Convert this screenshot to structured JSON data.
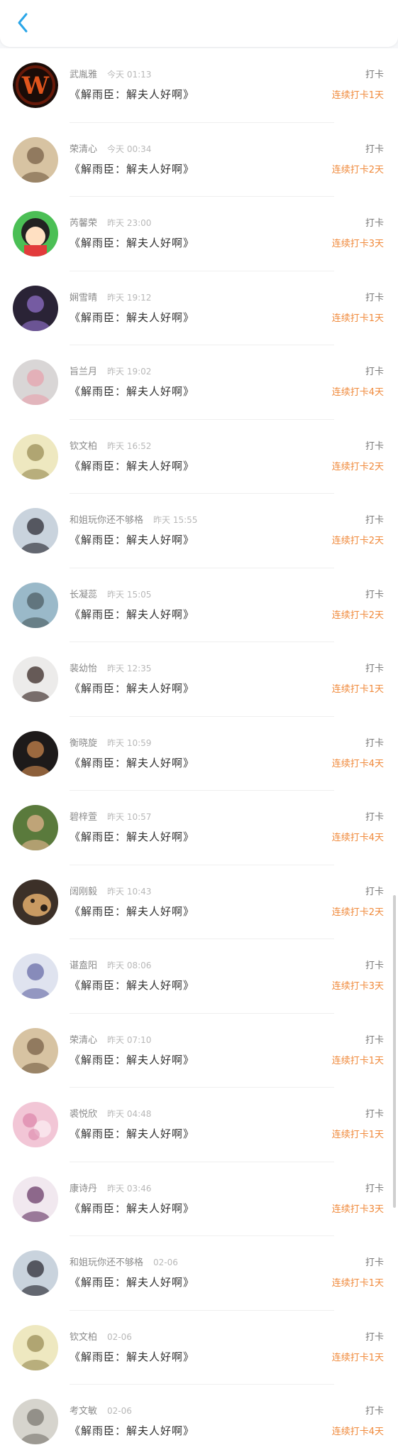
{
  "header": {
    "back_icon": "chevron-left-icon",
    "accent": "#2aa6e8"
  },
  "entries": [
    {
      "name": "武胤雅",
      "time": "今天 01:13",
      "title": "《解雨臣：解夫人好啊》",
      "action": "打卡",
      "streak": "连续打卡1天",
      "avatar": {
        "icon": "w-logo-avatar",
        "bg": "#1a0c08",
        "fg": "#e0541c"
      }
    },
    {
      "name": "荣清心",
      "time": "今天 00:34",
      "title": "《解雨臣：解夫人好啊》",
      "action": "打卡",
      "streak": "连续打卡2天",
      "avatar": {
        "icon": "anime-girl-avatar",
        "bg": "#d7c3a2",
        "fg": "#7a6248"
      }
    },
    {
      "name": "芮馨荣",
      "time": "昨天 23:00",
      "title": "《解雨臣：解夫人好啊》",
      "action": "打卡",
      "streak": "连续打卡3天",
      "avatar": {
        "icon": "cartoon-girl-avatar",
        "bg": "#4bbf55",
        "fg": "#e23b3b"
      }
    },
    {
      "name": "娴雪晴",
      "time": "昨天 19:12",
      "title": "《解雨臣：解夫人好啊》",
      "action": "打卡",
      "streak": "连续打卡1天",
      "avatar": {
        "icon": "night-photo-avatar",
        "bg": "#2a2336",
        "fg": "#8f6fc7"
      }
    },
    {
      "name": "旨兰月",
      "time": "昨天 19:02",
      "title": "《解雨臣：解夫人好啊》",
      "action": "打卡",
      "streak": "连续打卡4天",
      "avatar": {
        "icon": "still-life-avatar",
        "bg": "#d9d6d6",
        "fg": "#e6a3ad"
      }
    },
    {
      "name": "钦文柏",
      "time": "昨天 16:52",
      "title": "《解雨臣：解夫人好啊》",
      "action": "打卡",
      "streak": "连续打卡2天",
      "avatar": {
        "icon": "sketch-character-avatar",
        "bg": "#eee8c0",
        "fg": "#9b8f58"
      }
    },
    {
      "name": "和姐玩你还不够格",
      "time": "昨天 15:55",
      "title": "《解雨臣：解夫人好啊》",
      "action": "打卡",
      "streak": "连续打卡2天",
      "avatar": {
        "icon": "long-hair-girl-avatar",
        "bg": "#c9d3dd",
        "fg": "#2d2d35"
      }
    },
    {
      "name": "长凝蕊",
      "time": "昨天 15:05",
      "title": "《解雨臣：解夫人好啊》",
      "action": "打卡",
      "streak": "连续打卡2天",
      "avatar": {
        "icon": "seaside-avatar",
        "bg": "#9ab9c9",
        "fg": "#4d5f64"
      }
    },
    {
      "name": "裴幼怡",
      "time": "昨天 12:35",
      "title": "《解雨臣：解夫人好啊》",
      "action": "打卡",
      "streak": "连续打卡1天",
      "avatar": {
        "icon": "girl-portrait-avatar",
        "bg": "#ecebea",
        "fg": "#3a2a26"
      }
    },
    {
      "name": "衡晓旋",
      "time": "昨天 10:59",
      "title": "《解雨臣：解夫人好啊》",
      "action": "打卡",
      "streak": "连续打卡4天",
      "avatar": {
        "icon": "dark-portrait-avatar",
        "bg": "#1d1a1a",
        "fg": "#c7844c"
      }
    },
    {
      "name": "碧梓萱",
      "time": "昨天 10:57",
      "title": "《解雨臣：解夫人好啊》",
      "action": "打卡",
      "streak": "连续打卡4天",
      "avatar": {
        "icon": "garden-girl-avatar",
        "bg": "#5a7a3c",
        "fg": "#e1b38c"
      }
    },
    {
      "name": "阔刚毅",
      "time": "昨天 10:43",
      "title": "《解雨臣：解夫人好啊》",
      "action": "打卡",
      "streak": "连续打卡2天",
      "avatar": {
        "icon": "dog-avatar",
        "bg": "#3c3028",
        "fg": "#c99a62"
      }
    },
    {
      "name": "谌盍阳",
      "time": "昨天 08:06",
      "title": "《解雨臣：解夫人好啊》",
      "action": "打卡",
      "streak": "连续打卡3天",
      "avatar": {
        "icon": "anime-hero-avatar",
        "bg": "#dfe3ef",
        "fg": "#6a6ea8"
      }
    },
    {
      "name": "荣清心",
      "time": "昨天 07:10",
      "title": "《解雨臣：解夫人好啊》",
      "action": "打卡",
      "streak": "连续打卡1天",
      "avatar": {
        "icon": "anime-girl-avatar",
        "bg": "#d7c3a2",
        "fg": "#7a6248"
      }
    },
    {
      "name": "裘悦欣",
      "time": "昨天 04:48",
      "title": "《解雨臣：解夫人好啊》",
      "action": "打卡",
      "streak": "连续打卡1天",
      "avatar": {
        "icon": "pink-floral-avatar",
        "bg": "#f2c6d6",
        "fg": "#d87aa1"
      }
    },
    {
      "name": "康诗丹",
      "time": "昨天 03:46",
      "title": "《解雨臣：解夫人好啊》",
      "action": "打卡",
      "streak": "连续打卡3天",
      "avatar": {
        "icon": "anime-purple-hair-avatar",
        "bg": "#f1e8ef",
        "fg": "#6b3e6a"
      }
    },
    {
      "name": "和姐玩你还不够格",
      "time": "02-06",
      "title": "《解雨臣：解夫人好啊》",
      "action": "打卡",
      "streak": "连续打卡1天",
      "avatar": {
        "icon": "long-hair-girl-avatar",
        "bg": "#c9d3dd",
        "fg": "#2d2d35"
      }
    },
    {
      "name": "钦文柏",
      "time": "02-06",
      "title": "《解雨臣：解夫人好啊》",
      "action": "打卡",
      "streak": "连续打卡1天",
      "avatar": {
        "icon": "sketch-character-avatar",
        "bg": "#eee8c0",
        "fg": "#9b8f58"
      }
    },
    {
      "name": "考文敏",
      "time": "02-06",
      "title": "《解雨臣：解夫人好啊》",
      "action": "打卡",
      "streak": "连续打卡4天",
      "avatar": {
        "icon": "outdoor-girl-avatar",
        "bg": "#d6d4cd",
        "fg": "#7c7a72"
      }
    }
  ]
}
